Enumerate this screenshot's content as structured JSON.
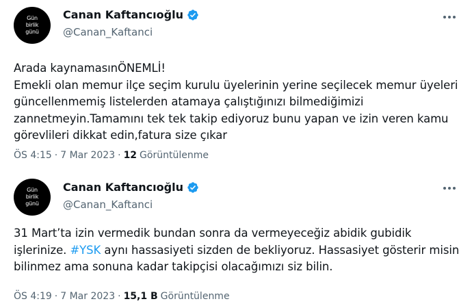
{
  "colors": {
    "verified": "#1d9bf0",
    "hashtag": "#1d9bf0",
    "secondary_text": "#536471"
  },
  "tweets": [
    {
      "avatar": {
        "line1": "Gün",
        "line2": "birlik",
        "line3": "günü"
      },
      "display_name": "Canan Kaftancıoğlu",
      "handle": "@Canan_Kaftanci",
      "badge_icon": "verified-badge-icon",
      "more_icon": "more-options-icon",
      "text": "Arada kaynamasınÖNEMLİ!\nEmekli olan memur ilçe seçim kurulu üyelerinin yerine seçilecek memur üyeleri güncellenmemiş listelerden atamaya çalıştığınızı bilmediğimizi zannetmeyin.Tamamını tek tek takip ediyoruz bunu yapan ve izin veren kamu görevlileri dikkat edin,fatura size çıkar",
      "time": "ÖS 4:15",
      "separator": "·",
      "date": "7 Mar 2023",
      "views_count": "12",
      "views_label": "Görüntülenme"
    },
    {
      "avatar": {
        "line1": "Gün",
        "line2": "birlik",
        "line3": "günü"
      },
      "display_name": "Canan Kaftancıoğlu",
      "handle": "@Canan_Kaftanci",
      "badge_icon": "verified-badge-icon",
      "more_icon": "more-options-icon",
      "text_before": "31 Mart’ta izin vermedik bundan sonra da vermeyeceğiz abidik gubidik işlerinize. ",
      "hashtag": "#YSK",
      "text_after": " aynı hassasiyeti sizden de bekliyoruz. Hassasiyet gösterir misin bilinmez ama sonuna kadar takipçisi olacağımızı siz bilin.",
      "time": "ÖS 4:19",
      "separator": "·",
      "date": "7 Mar 2023",
      "views_count": "15,1 B",
      "views_label": "Görüntülenme"
    }
  ]
}
